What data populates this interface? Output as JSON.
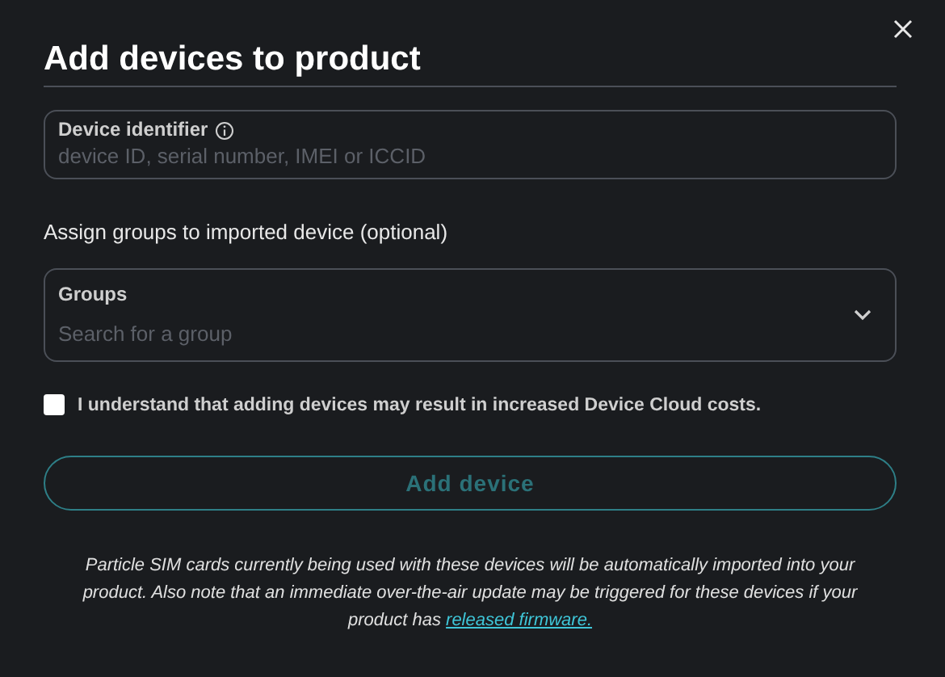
{
  "dialog": {
    "title": "Add devices to product"
  },
  "identifier_field": {
    "label": "Device identifier",
    "placeholder": "device ID, serial number, IMEI or ICCID"
  },
  "groups_section": {
    "heading": "Assign groups to imported device (optional)"
  },
  "groups_field": {
    "label": "Groups",
    "placeholder": "Search for a group"
  },
  "consent": {
    "label": "I understand that adding devices may result in increased Device Cloud costs.",
    "checked": false
  },
  "submit_button": {
    "label": "Add device",
    "disabled": true
  },
  "note": {
    "text": "Particle SIM cards currently being used with these devices will be automatically imported into your product. Also note that an immediate over-the-air update may be triggered for these devices if your product has",
    "link": "released firmware."
  }
}
